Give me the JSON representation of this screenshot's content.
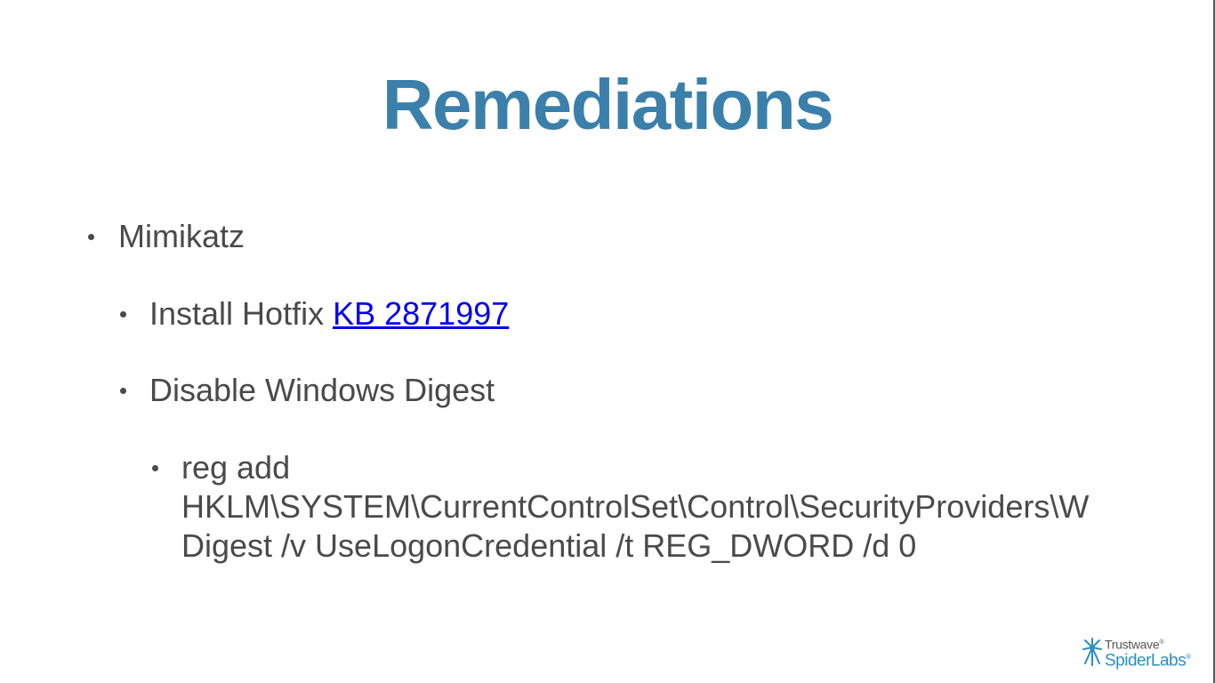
{
  "slide": {
    "title": "Remediations",
    "bullets": {
      "level1": "Mimikatz",
      "hotfix_prefix": "Install Hotfix ",
      "hotfix_link": "KB 2871997",
      "digest": "Disable Windows Digest",
      "reg_line1": "reg add",
      "reg_line2": "HKLM\\SYSTEM\\CurrentControlSet\\Control\\SecurityProviders\\W",
      "reg_line3": "Digest /v UseLogonCredential /t REG_DWORD /d 0"
    },
    "logo": {
      "top": "Trustwave",
      "bottom": "SpiderLabs",
      "reg": "®"
    },
    "colors": {
      "title": "#3b7fab",
      "text": "#4a4a4a",
      "link": "#0000ee",
      "logo_blue": "#2a8fc1"
    }
  }
}
